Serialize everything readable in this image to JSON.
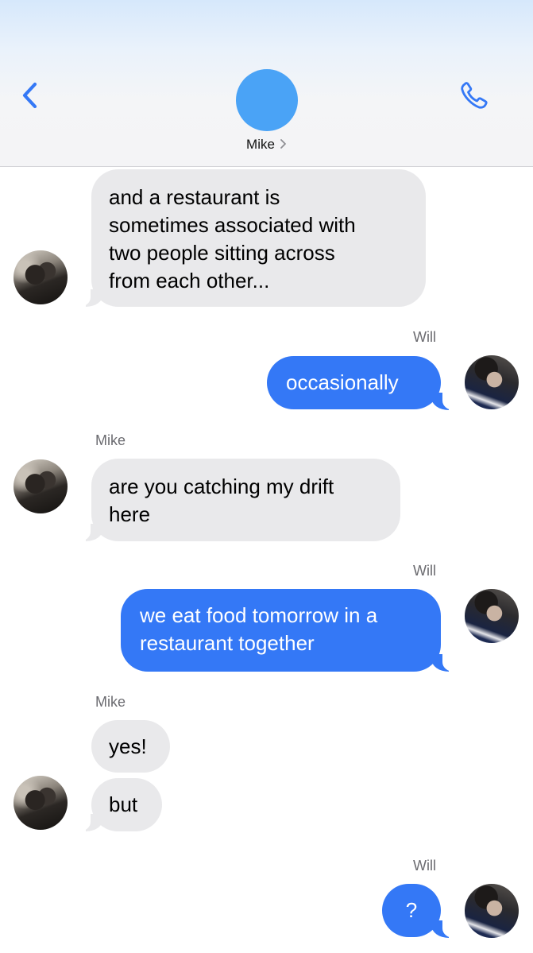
{
  "header": {
    "contact_name": "Mike",
    "back_icon": "chevron-left-icon",
    "call_icon": "phone-icon",
    "accent": "#3478f6",
    "avatar_color": "#4aa3f6"
  },
  "messages": [
    {
      "sender": "Mike",
      "show_sender": false,
      "lines": [
        "and a restaurant is",
        "sometimes associated with",
        "two people sitting across",
        "from each other..."
      ]
    },
    {
      "sender": "Will",
      "show_sender": true,
      "lines": [
        "occasionally"
      ]
    },
    {
      "sender": "Mike",
      "show_sender": true,
      "lines": [
        "are you catching my drift",
        "here"
      ]
    },
    {
      "sender": "Will",
      "show_sender": true,
      "lines": [
        "we eat food tomorrow in a",
        "restaurant together"
      ]
    },
    {
      "sender": "Mike",
      "show_sender": true,
      "lines": [
        "yes!"
      ]
    },
    {
      "sender": "Mike",
      "show_sender": false,
      "lines": [
        "but"
      ]
    },
    {
      "sender": "Will",
      "show_sender": true,
      "lines": [
        "?"
      ]
    }
  ],
  "colors": {
    "incoming_bubble": "#e9e9eb",
    "outgoing_bubble": "#3478f6"
  }
}
